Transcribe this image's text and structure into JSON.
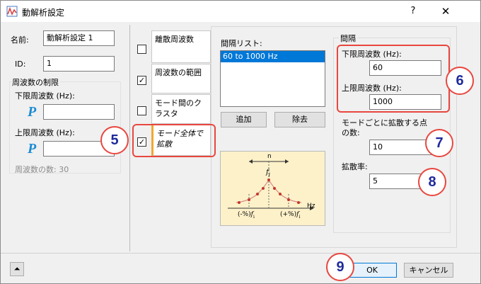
{
  "window": {
    "title": "動解析設定",
    "help_label": "?",
    "close_label": "✕"
  },
  "left": {
    "name_label": "名前:",
    "name_value": "動解析設定 1",
    "id_label": "ID:",
    "id_value": "1",
    "freq_limit_group": "周波数の制限",
    "lower_label": "下限周波数 (Hz):",
    "upper_label": "上限周波数 (Hz):",
    "p_icon_text": "P",
    "count_label": "周波数の数: 30"
  },
  "modes": {
    "items": [
      {
        "label": "離散周波数",
        "checked": false
      },
      {
        "label": "周波数の範囲",
        "checked": true
      },
      {
        "label": "モード間のクラスタ",
        "checked": false
      },
      {
        "label": "モード全体で拡散",
        "checked": true
      }
    ],
    "check_mark": "✓"
  },
  "interval_list": {
    "label": "間隔リスト:",
    "items": [
      "60 to 1000 Hz"
    ],
    "add_label": "追加",
    "remove_label": "除去"
  },
  "diagram": {
    "n_label": "n",
    "fi_label": "f",
    "fi_sub": "i",
    "hz_label": "Hz",
    "left_label": "(-%)",
    "right_label": "(+%)"
  },
  "interval": {
    "group_label": "間隔",
    "lower_label": "下限周波数 (Hz):",
    "lower_value": "60",
    "upper_label": "上限周波数 (Hz):",
    "upper_value": "1000",
    "points_label_1": "モードごとに拡散する点",
    "points_label_2": "の数:",
    "points_value": "10",
    "spread_label": "拡散率:",
    "spread_value": "5"
  },
  "footer": {
    "expand_icon": "⏶",
    "ok_label": "OK",
    "cancel_label": "キャンセル"
  },
  "callouts": [
    "5",
    "6",
    "7",
    "8",
    "9"
  ],
  "colors": {
    "callout": "#e8473f",
    "callout_text": "#1f2a9c",
    "selection": "#0078d7",
    "p_icon": "#1c8cd4"
  }
}
